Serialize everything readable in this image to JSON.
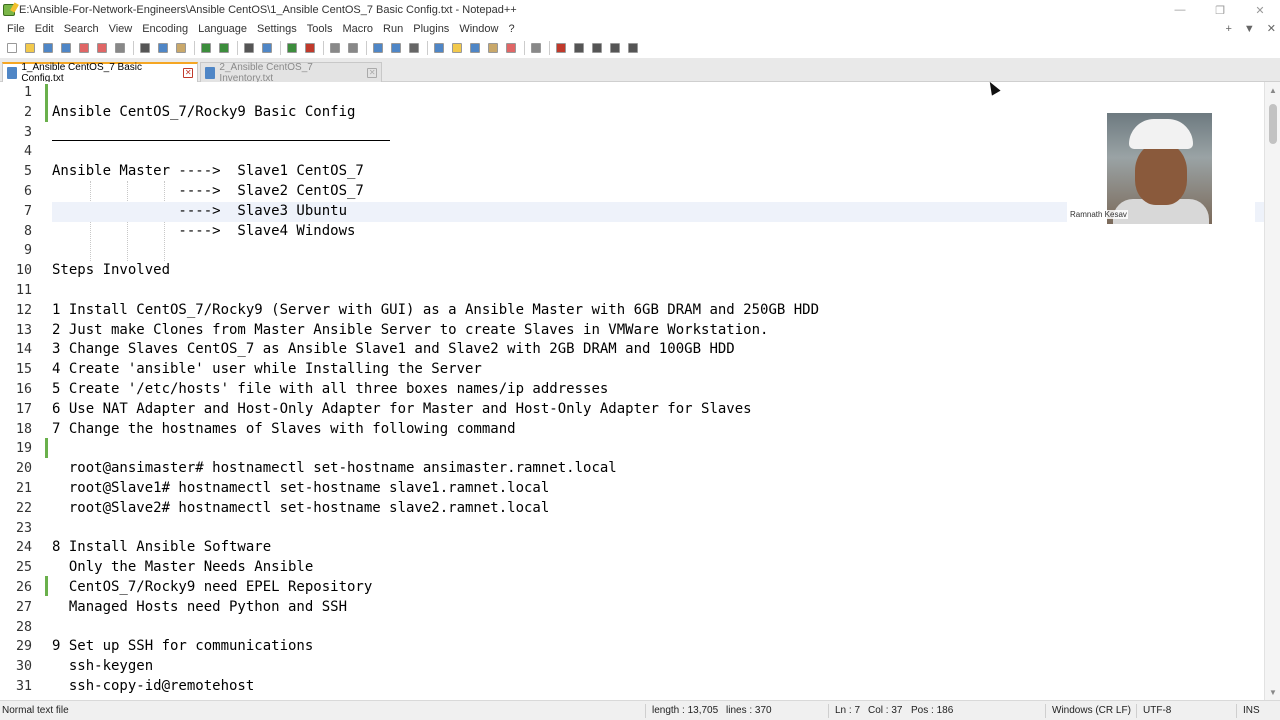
{
  "window": {
    "title": "E:\\Ansible-For-Network-Engineers\\Ansible CentOS\\1_Ansible CentOS_7 Basic Config.txt - Notepad++",
    "minimize_glyph": "—",
    "restore_glyph": "❐",
    "close_glyph": "✕"
  },
  "menu": {
    "items": [
      "File",
      "Edit",
      "Search",
      "View",
      "Encoding",
      "Language",
      "Settings",
      "Tools",
      "Macro",
      "Run",
      "Plugins",
      "Window",
      "?"
    ],
    "right": [
      "+",
      "▼",
      "✕"
    ]
  },
  "toolbar": {
    "buttons": [
      {
        "icon": "new-file-icon",
        "color": "#ffffff"
      },
      {
        "icon": "open-file-icon",
        "color": "#f2c94c"
      },
      {
        "icon": "save-icon",
        "color": "#4f86c6"
      },
      {
        "icon": "save-all-icon",
        "color": "#4f86c6"
      },
      {
        "icon": "close-file-icon",
        "color": "#e06666"
      },
      {
        "icon": "close-all-icon",
        "color": "#e06666"
      },
      {
        "icon": "print-icon",
        "color": "#888888"
      },
      {
        "icon": "sep"
      },
      {
        "icon": "cut-icon",
        "color": "#555555"
      },
      {
        "icon": "copy-icon",
        "color": "#4f86c6"
      },
      {
        "icon": "paste-icon",
        "color": "#c9a86a"
      },
      {
        "icon": "sep"
      },
      {
        "icon": "undo-icon",
        "color": "#3c8d3c"
      },
      {
        "icon": "redo-icon",
        "color": "#3c8d3c"
      },
      {
        "icon": "sep"
      },
      {
        "icon": "find-icon",
        "color": "#555555"
      },
      {
        "icon": "replace-icon",
        "color": "#4f86c6"
      },
      {
        "icon": "sep"
      },
      {
        "icon": "zoom-in-icon",
        "color": "#3c8d3c"
      },
      {
        "icon": "zoom-out-icon",
        "color": "#c0392b"
      },
      {
        "icon": "sep"
      },
      {
        "icon": "sync-vertical-icon",
        "color": "#888888"
      },
      {
        "icon": "sync-horizontal-icon",
        "color": "#888888"
      },
      {
        "icon": "sep"
      },
      {
        "icon": "word-wrap-icon",
        "color": "#4f86c6"
      },
      {
        "icon": "show-all-chars-icon",
        "color": "#4f86c6"
      },
      {
        "icon": "indent-guide-icon",
        "color": "#666666"
      },
      {
        "icon": "sep"
      },
      {
        "icon": "udl-icon",
        "color": "#4f86c6"
      },
      {
        "icon": "doc-map-icon",
        "color": "#f2c94c"
      },
      {
        "icon": "function-list-icon",
        "color": "#4f86c6"
      },
      {
        "icon": "folder-workspace-icon",
        "color": "#c9a86a"
      },
      {
        "icon": "doc-list-icon",
        "color": "#e06666"
      },
      {
        "icon": "sep"
      },
      {
        "icon": "monitoring-icon",
        "color": "#888888"
      },
      {
        "icon": "sep"
      },
      {
        "icon": "record-macro-icon",
        "color": "#c0392b"
      },
      {
        "icon": "stop-macro-icon",
        "color": "#555555"
      },
      {
        "icon": "play-macro-icon",
        "color": "#555555"
      },
      {
        "icon": "run-macro-multiple-icon",
        "color": "#555555"
      },
      {
        "icon": "save-macro-icon",
        "color": "#555555"
      }
    ]
  },
  "tabs": [
    {
      "label": "1_Ansible CentOS_7 Basic Config.txt",
      "active": true
    },
    {
      "label": "2_Ansible CentOS_7 Inventory.txt",
      "active": false
    }
  ],
  "editor": {
    "current_line": 7,
    "lines": [
      {
        "n": "1",
        "text": ""
      },
      {
        "n": "2",
        "text": "Ansible CentOS_7/Rocky9 Basic Config"
      },
      {
        "n": "3",
        "text": ""
      },
      {
        "n": "4",
        "text": ""
      },
      {
        "n": "5",
        "text": "Ansible Master ---->  Slave1 CentOS_7"
      },
      {
        "n": "6",
        "text": "               ---->  Slave2 CentOS_7"
      },
      {
        "n": "7",
        "text": "               ---->  Slave3 Ubuntu"
      },
      {
        "n": "8",
        "text": "               ---->  Slave4 Windows"
      },
      {
        "n": "9",
        "text": ""
      },
      {
        "n": "10",
        "text": "Steps Involved"
      },
      {
        "n": "11",
        "text": ""
      },
      {
        "n": "12",
        "text": "1 Install CentOS_7/Rocky9 (Server with GUI) as a Ansible Master with 6GB DRAM and 250GB HDD"
      },
      {
        "n": "13",
        "text": "2 Just make Clones from Master Ansible Server to create Slaves in VMWare Workstation."
      },
      {
        "n": "14",
        "text": "3 Change Slaves CentOS_7 as Ansible Slave1 and Slave2 with 2GB DRAM and 100GB HDD"
      },
      {
        "n": "15",
        "text": "4 Create 'ansible' user while Installing the Server"
      },
      {
        "n": "16",
        "text": "5 Create '/etc/hosts' file with all three boxes names/ip addresses"
      },
      {
        "n": "17",
        "text": "6 Use NAT Adapter and Host-Only Adapter for Master and Host-Only Adapter for Slaves"
      },
      {
        "n": "18",
        "text": "7 Change the hostnames of Slaves with following command"
      },
      {
        "n": "19",
        "text": ""
      },
      {
        "n": "20",
        "text": "  root@ansimaster# hostnamectl set-hostname ansimaster.ramnet.local"
      },
      {
        "n": "21",
        "text": "  root@Slave1# hostnamectl set-hostname slave1.ramnet.local"
      },
      {
        "n": "22",
        "text": "  root@Slave2# hostnamectl set-hostname slave2.ramnet.local"
      },
      {
        "n": "23",
        "text": ""
      },
      {
        "n": "24",
        "text": "8 Install Ansible Software"
      },
      {
        "n": "25",
        "text": "  Only the Master Needs Ansible"
      },
      {
        "n": "26",
        "text": "  CentOS_7/Rocky9 need EPEL Repository"
      },
      {
        "n": "27",
        "text": "  Managed Hosts need Python and SSH"
      },
      {
        "n": "28",
        "text": ""
      },
      {
        "n": "29",
        "text": "9 Set up SSH for communications"
      },
      {
        "n": "30",
        "text": "  ssh-keygen"
      },
      {
        "n": "31",
        "text": "  ssh-copy-id@remotehost"
      }
    ]
  },
  "webcam": {
    "name_label": "Ramnath Kesav"
  },
  "status": {
    "file_type": "Normal text file",
    "length": "length : 13,705",
    "lines": "lines : 370",
    "ln": "Ln : 7",
    "col": "Col : 37",
    "pos": "Pos : 186",
    "eol": "Windows (CR LF)",
    "encoding": "UTF-8",
    "ins": "INS"
  }
}
